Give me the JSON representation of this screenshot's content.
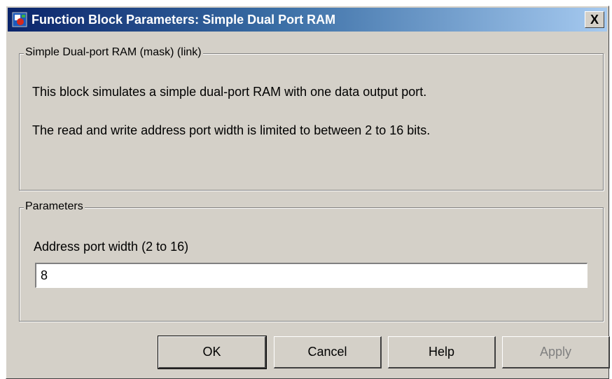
{
  "window": {
    "title": "Function Block Parameters: Simple Dual Port RAM",
    "close_label": "X"
  },
  "description_group": {
    "legend": "Simple Dual-port RAM (mask) (link)",
    "line1": "This block simulates a simple dual-port RAM with one data output port.",
    "line2": "The read and write address port width is limited to between 2 to 16 bits."
  },
  "parameters_group": {
    "legend": "Parameters",
    "address_port_width_label": "Address port width (2 to 16)",
    "address_port_width_value": "8"
  },
  "buttons": {
    "ok": "OK",
    "cancel": "Cancel",
    "help": "Help",
    "apply": "Apply"
  },
  "icons": {
    "app": "simulink-block-icon",
    "close": "close-icon"
  },
  "colors": {
    "dialog_bg": "#d4d0c8",
    "title_start": "#0a246a",
    "title_end": "#a6caf0",
    "disabled_text": "#808080"
  }
}
